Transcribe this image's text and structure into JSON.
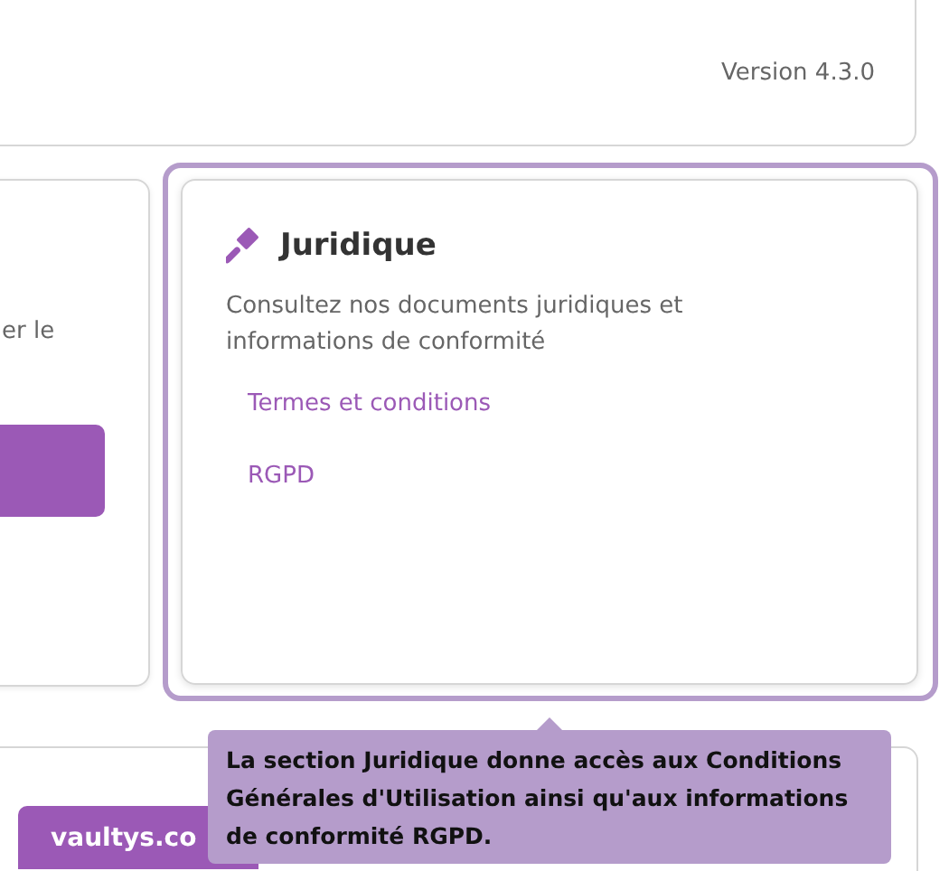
{
  "header": {
    "version": "Version 4.3.0"
  },
  "left_card": {
    "text_fragment": "er le"
  },
  "legal_card": {
    "title": "Juridique",
    "description": "Consultez nos documents juridiques et informations de conformité",
    "highlighted": true,
    "links": [
      "Termes et conditions",
      "RGPD"
    ]
  },
  "bottom_card": {
    "button": "vaultys.co"
  },
  "tooltip": {
    "text": "La section Juridique donne accès aux Conditions Générales d'Utilisation ainsi qu'aux informations de conformité RGPD."
  }
}
